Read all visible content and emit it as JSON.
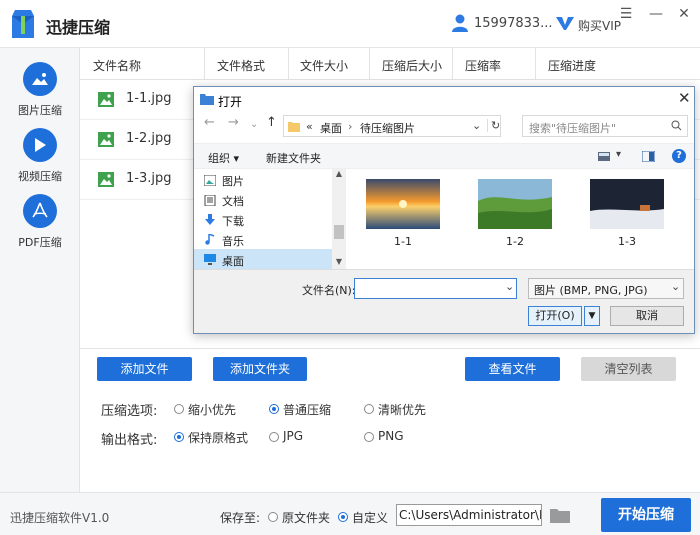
{
  "app": {
    "title": "迅捷压缩",
    "phone": "15997833...",
    "vip_label": "购买VIP",
    "version": "迅捷压缩软件V1.0",
    "accent": "#1e6fd9"
  },
  "sidebar": {
    "items": [
      {
        "label": "图片压缩",
        "icon": "image-icon"
      },
      {
        "label": "视频压缩",
        "icon": "play-icon"
      },
      {
        "label": "PDF压缩",
        "icon": "pdf-icon"
      }
    ]
  },
  "table": {
    "columns": [
      "文件名称",
      "文件格式",
      "文件大小",
      "压缩后大小",
      "压缩率",
      "压缩进度"
    ],
    "rows": [
      {
        "name": "1-1.jpg"
      },
      {
        "name": "1-2.jpg"
      },
      {
        "name": "1-3.jpg"
      }
    ]
  },
  "actions": {
    "add_file": "添加文件",
    "add_folder": "添加文件夹",
    "view_file": "查看文件",
    "clear_list": "清空列表"
  },
  "options": {
    "compress_label": "压缩选项:",
    "compress_options": [
      "缩小优先",
      "普通压缩",
      "清晰优先"
    ],
    "compress_selected": "普通压缩",
    "format_label": "输出格式:",
    "format_options": [
      "保持原格式",
      "JPG",
      "PNG"
    ],
    "format_selected": "保持原格式"
  },
  "footer": {
    "save_label": "保存至:",
    "save_options": [
      "原文件夹",
      "自定义"
    ],
    "save_selected": "自定义",
    "path": "C:\\Users\\Administrator\\Desktop",
    "start_button": "开始压缩"
  },
  "dialog": {
    "title": "打开",
    "breadcrumb_prefix": "«",
    "breadcrumb": [
      "桌面",
      "待压缩图片"
    ],
    "search_placeholder": "搜索\"待压缩图片\"",
    "organize": "组织 ▾",
    "new_folder": "新建文件夹",
    "tree": [
      "图片",
      "文档",
      "下载",
      "音乐",
      "桌面"
    ],
    "thumbnails": [
      "1-1",
      "1-2",
      "1-3"
    ],
    "filename_label": "文件名(N):",
    "filename_value": "",
    "filter": "图片 (BMP, PNG, JPG)",
    "open_button": "打开(O)",
    "cancel_button": "取消"
  }
}
